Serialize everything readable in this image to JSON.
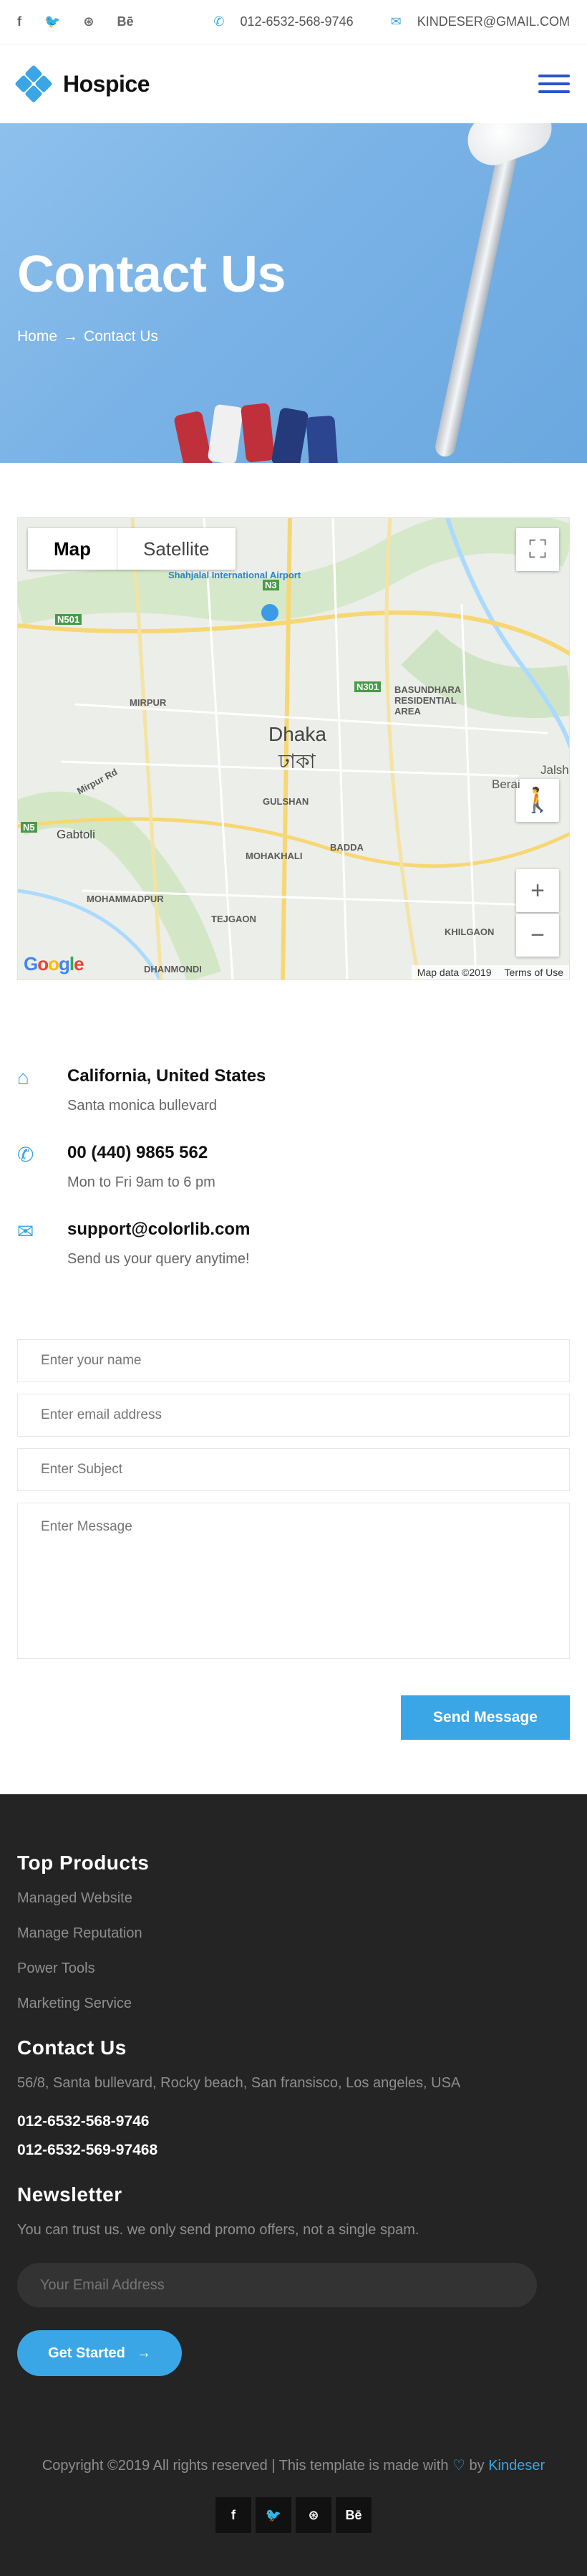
{
  "topbar": {
    "socials": [
      {
        "name": "facebook-icon",
        "glyph": "f"
      },
      {
        "name": "twitter-icon",
        "glyph": "🐦"
      },
      {
        "name": "dribbble-icon",
        "glyph": "⊛"
      },
      {
        "name": "behance-icon",
        "glyph": "Bē"
      }
    ],
    "phone": "012-6532-568-9746",
    "email": "KINDESER@GMAIL.COM"
  },
  "header": {
    "brand": "Hospice"
  },
  "hero": {
    "title": "Contact Us",
    "breadcrumb_home": "Home",
    "breadcrumb_sep": "→",
    "breadcrumb_current": "Contact Us"
  },
  "map": {
    "tab_map": "Map",
    "tab_satellite": "Satellite",
    "labels": {
      "airport": "Shahjalal International Airport",
      "mirpur": "MIRPUR",
      "dhaka": "Dhaka",
      "dhaka_bn": "ঢাকা",
      "gulshan": "GULSHAN",
      "badda": "BADDA",
      "mohakhali": "MOHAKHALI",
      "basundhara": "BASUNDHARA RESIDENTIAL AREA",
      "gabtoli": "Gabtoli",
      "mohammadpur": "MOHAMMADPUR",
      "tejgaon": "TEJGAON",
      "khilgaon": "KHILGAON",
      "dhanmondi": "DHANMONDI",
      "jalsh": "Jalsh",
      "berai": "Berai",
      "mirpur_rd": "Mirpur Rd",
      "n501": "N501",
      "n3": "N3",
      "n301": "N301",
      "n5": "N5"
    },
    "data_label": "Map data ©2019",
    "terms": "Terms of Use",
    "google": "Google"
  },
  "contact_info": [
    {
      "icon": "home-icon",
      "title": "California, United States",
      "desc": "Santa monica bullevard"
    },
    {
      "icon": "phone-icon",
      "title": "00 (440) 9865 562",
      "desc": "Mon to Fri 9am to 6 pm"
    },
    {
      "icon": "mail-icon",
      "title": "support@colorlib.com",
      "desc": "Send us your query anytime!"
    }
  ],
  "form": {
    "name_placeholder": "Enter your name",
    "email_placeholder": "Enter email address",
    "subject_placeholder": "Enter Subject",
    "message_placeholder": "Enter Message",
    "submit_label": "Send Message"
  },
  "footer": {
    "products_title": "Top Products",
    "products": [
      "Managed Website",
      "Manage Reputation",
      "Power Tools",
      "Marketing Service"
    ],
    "contact_title": "Contact Us",
    "address": "56/8, Santa bullevard, Rocky beach, San fransisco, Los angeles, USA",
    "phone1": "012-6532-568-9746",
    "phone2": "012-6532-569-97468",
    "newsletter_title": "Newsletter",
    "newsletter_desc": "You can trust us. we only send promo offers, not a single spam.",
    "email_placeholder": "Your Email Address",
    "cta_label": "Get Started",
    "copyright_pre": "Copyright ©2019 All rights reserved | This template is made with",
    "copyright_by": "by",
    "copyright_brand": "Kindeser",
    "socials": [
      {
        "name": "facebook-icon",
        "glyph": "f"
      },
      {
        "name": "twitter-icon",
        "glyph": "🐦"
      },
      {
        "name": "dribbble-icon",
        "glyph": "⊛"
      },
      {
        "name": "behance-icon",
        "glyph": "Bē"
      }
    ]
  },
  "colors": {
    "accent": "#3aa6e6",
    "footer_bg": "#242424",
    "menu": "#2a55c7"
  }
}
